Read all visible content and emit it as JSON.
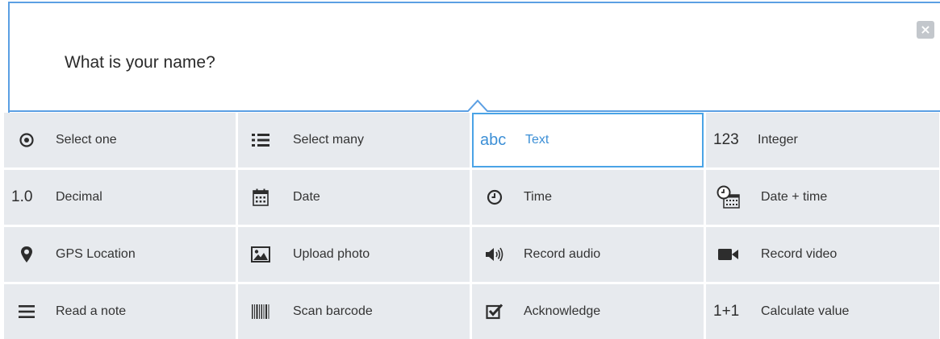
{
  "question": {
    "text": "What is your name?"
  },
  "close": {
    "glyph": "×"
  },
  "colors": {
    "accent": "#4aa3e6",
    "cell_bg": "#e7eaee"
  },
  "types": [
    {
      "label": "Select one",
      "icon": "radio-dot-icon"
    },
    {
      "label": "Select many",
      "icon": "list-icon"
    },
    {
      "label": "Text",
      "icon_text": "abc",
      "icon": "abc-text-icon",
      "selected": true
    },
    {
      "label": "Integer",
      "icon_text": "123",
      "icon": "integer-icon"
    },
    {
      "label": "Decimal",
      "icon_text": "1.0",
      "icon": "decimal-icon"
    },
    {
      "label": "Date",
      "icon": "calendar-icon"
    },
    {
      "label": "Time",
      "icon": "clock-icon"
    },
    {
      "label": "Date + time",
      "icon": "clock-calendar-icon"
    },
    {
      "label": "GPS Location",
      "icon": "map-pin-icon"
    },
    {
      "label": "Upload photo",
      "icon": "image-icon"
    },
    {
      "label": "Record audio",
      "icon": "speaker-icon"
    },
    {
      "label": "Record video",
      "icon": "video-camera-icon"
    },
    {
      "label": "Read a note",
      "icon": "menu-lines-icon"
    },
    {
      "label": "Scan barcode",
      "icon": "barcode-icon"
    },
    {
      "label": "Acknowledge",
      "icon": "checkbox-icon"
    },
    {
      "label": "Calculate value",
      "icon_text": "1+1",
      "icon": "calculate-icon"
    }
  ]
}
